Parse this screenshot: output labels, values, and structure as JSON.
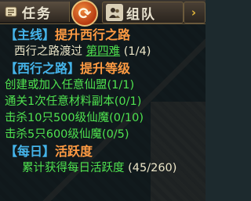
{
  "tabs": {
    "task_label": "任务",
    "team_label": "组队",
    "more_arrow": "›"
  },
  "refresh_glyph": "⟳",
  "quests": {
    "main": {
      "tag": "【主线】",
      "title": "提升西行之路",
      "desc": "西行之路渡过",
      "target": "第四难",
      "progress": "(1/4)"
    },
    "road": {
      "tag": "【西行之路】",
      "title": "提升等级",
      "items": [
        {
          "text": "创建或加入任意仙盟",
          "progress": "(1/1)"
        },
        {
          "text": "通关1次任意材料副本",
          "progress": "(0/1)"
        },
        {
          "text": "击杀10只500级仙魔",
          "progress": "(0/10)"
        },
        {
          "text": "击杀5只600级仙魔",
          "progress": "(0/5)"
        }
      ]
    },
    "daily": {
      "tag": "【每日】",
      "title": "活跃度",
      "desc": "累计获得每日活跃度",
      "progress": "(45/260)"
    }
  },
  "colors": {
    "header_blue": "#45b4ea",
    "title_orange": "#ff9b43",
    "green": "#4fe34f",
    "text": "#ece6c8"
  }
}
